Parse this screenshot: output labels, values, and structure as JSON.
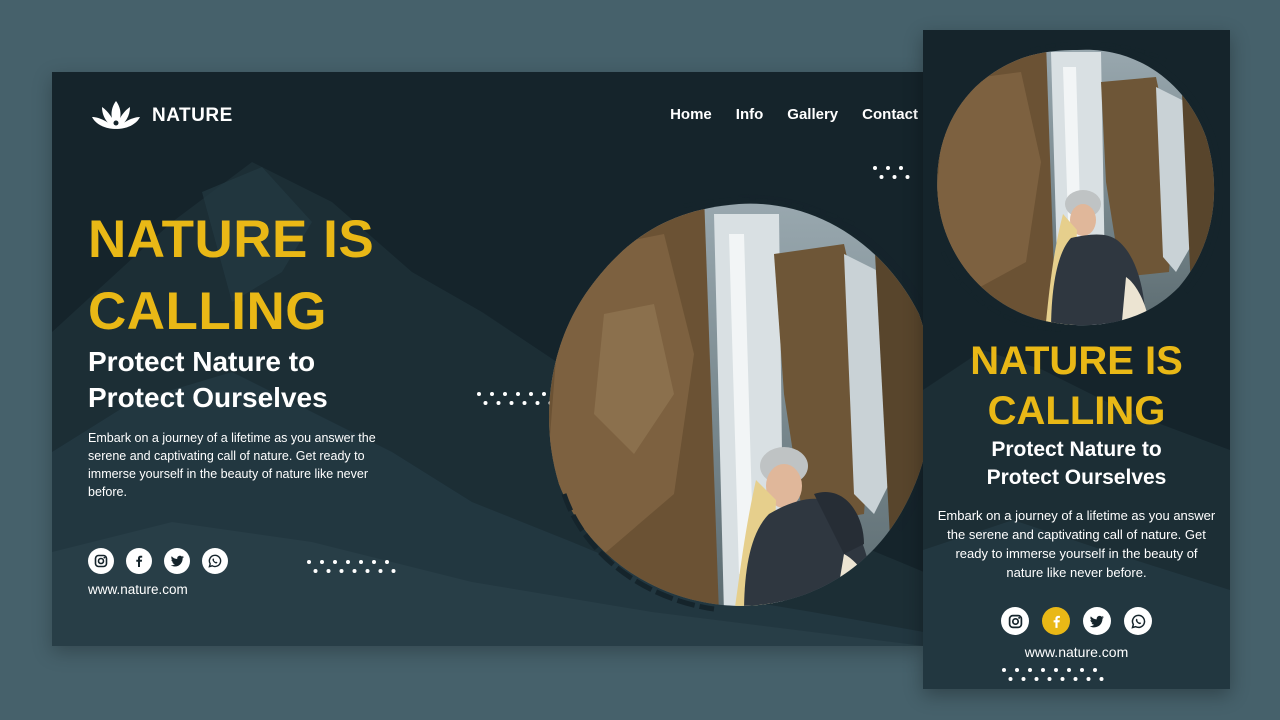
{
  "brand": {
    "name": "NATURE"
  },
  "nav": [
    {
      "label": "Home"
    },
    {
      "label": "Info"
    },
    {
      "label": "Gallery"
    },
    {
      "label": "Contact"
    }
  ],
  "hero": {
    "title_line1": "NATURE IS",
    "title_line2": "CALLING",
    "subtitle_line1": "Protect Nature to",
    "subtitle_line2": "Protect Ourselves",
    "description": "Embark on a journey of a lifetime as you answer the serene and captivating call of nature. Get ready to immerse yourself in the beauty of nature like never before."
  },
  "social": [
    {
      "icon": "instagram-icon"
    },
    {
      "icon": "facebook-icon"
    },
    {
      "icon": "twitter-icon"
    },
    {
      "icon": "whatsapp-icon"
    }
  ],
  "website": "www.nature.com",
  "colors": {
    "background": "#46616b",
    "panel": "#15242b",
    "accent": "#e9b816",
    "text": "#ffffff"
  }
}
